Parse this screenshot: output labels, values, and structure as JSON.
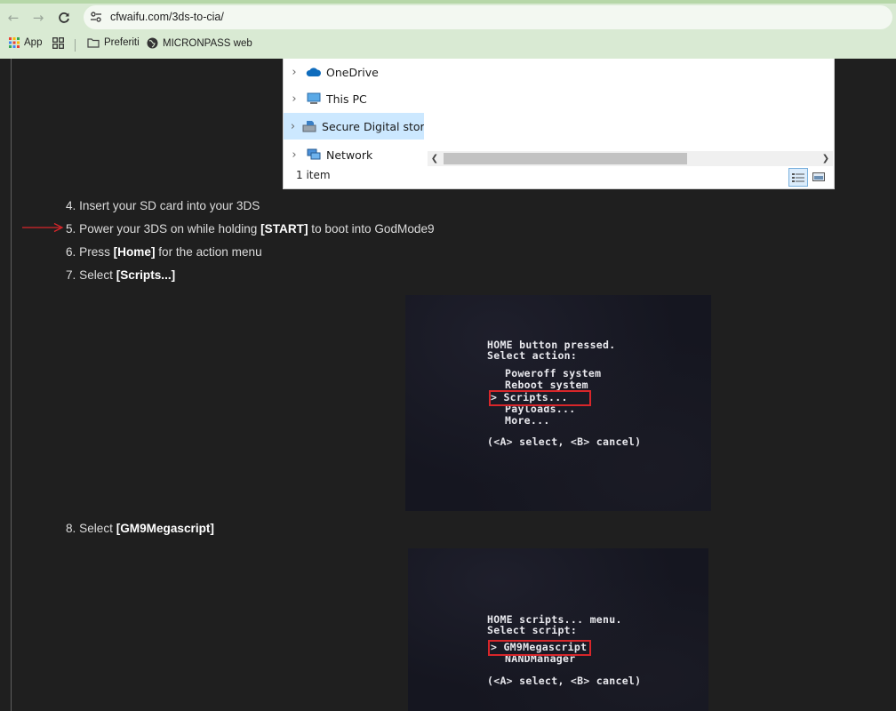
{
  "browser": {
    "url": "cfwaifu.com/3ds-to-cia/",
    "bookmarks": [
      "App",
      "Preferiti",
      "MICRONPASS web"
    ],
    "colors": {
      "toolbar": "#d9ead3",
      "omnibox": "#f3f8f1"
    },
    "icons": [
      "back-icon",
      "forward-icon",
      "reload-icon",
      "site-info-icon",
      "apps-grid-icon",
      "tab-groups-icon",
      "folder-icon",
      "globe-icon"
    ]
  },
  "explorer": {
    "tree": [
      {
        "label": "OneDrive",
        "icon": "onedrive-icon"
      },
      {
        "label": "This PC",
        "icon": "this-pc-icon"
      },
      {
        "label": "Secure Digital storag",
        "icon": "sd-storage-icon"
      },
      {
        "label": "Network",
        "icon": "network-icon"
      }
    ],
    "status": "1 item"
  },
  "steps": [
    {
      "num": "4.",
      "pre": "Insert your SD card into your 3DS",
      "bold": "",
      "post": ""
    },
    {
      "num": "5.",
      "pre": "Power your 3DS on while holding ",
      "bold": "[START]",
      "post": " to boot into GodMode9"
    },
    {
      "num": "6.",
      "pre": "Press ",
      "bold": "[Home]",
      "post": " for the action menu"
    },
    {
      "num": "7.",
      "pre": "Select ",
      "bold": "[Scripts...]",
      "post": ""
    },
    {
      "num": "8.",
      "pre": "Select ",
      "bold": "[GM9Megascript]",
      "post": ""
    }
  ],
  "screenshot1": {
    "header1": "HOME button pressed.",
    "header2": "Select action:",
    "options": [
      "Poweroff system",
      "Reboot system",
      "> Scripts...",
      "Payloads...",
      "More..."
    ],
    "footer": "(<A> select, <B> cancel)"
  },
  "screenshot2": {
    "header1": "HOME scripts... menu.",
    "header2": "Select script:",
    "options": [
      "> GM9Megascript",
      "NANDManager"
    ],
    "footer": "(<A> select, <B> cancel)"
  },
  "accent": {
    "annotation_red": "#d8262a",
    "page_bg": "#1f1f1f"
  }
}
